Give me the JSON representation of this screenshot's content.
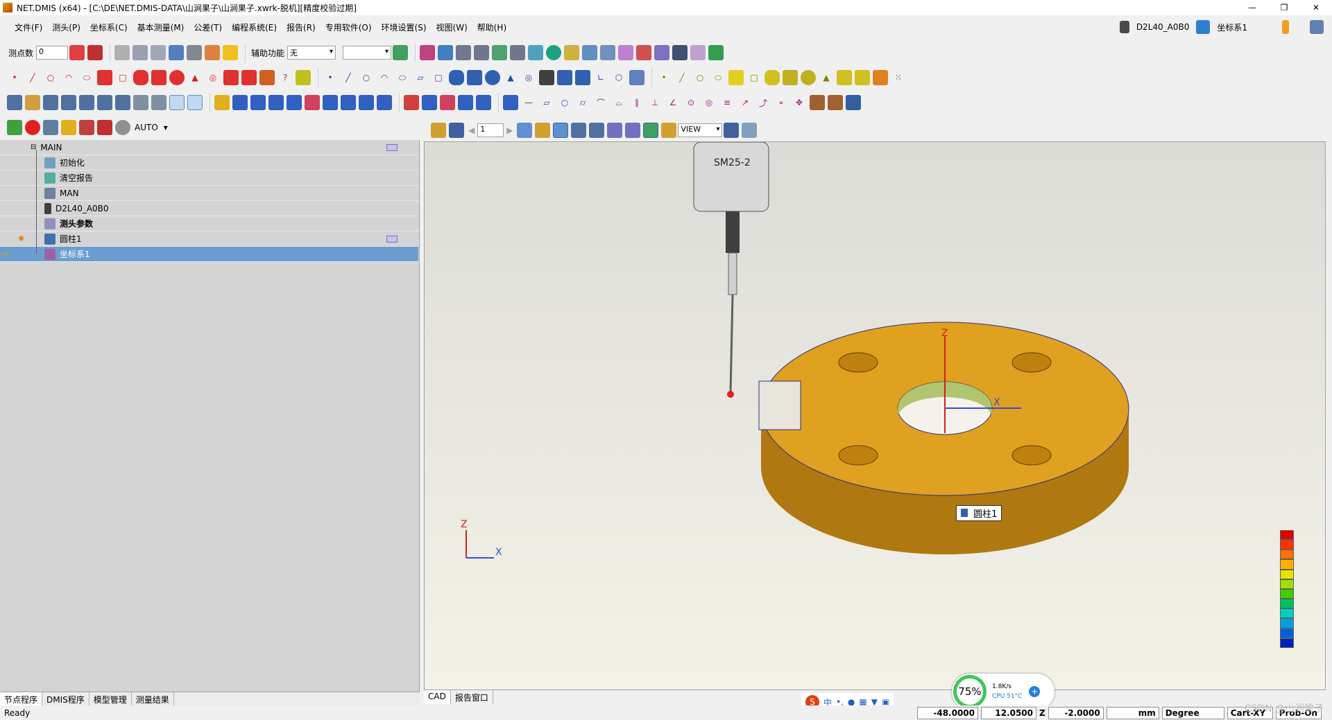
{
  "window": {
    "title": "NET.DMIS (x64) - [C:\\DE\\NET.DMIS-DATA\\山涧果子\\山涧果子.xwrk-脱机][精度校验过期]",
    "controls": [
      "—",
      "❐",
      "✕"
    ]
  },
  "menu": {
    "items": [
      "文件(F)",
      "测头(P)",
      "坐标系(C)",
      "基本测量(M)",
      "公差(T)",
      "编程系统(E)",
      "报告(R)",
      "专用软件(O)",
      "环境设置(S)",
      "视图(W)",
      "帮助(H)"
    ],
    "probe_name": "D2L40_A0B0",
    "coord_system": "坐标系1"
  },
  "toolbar": {
    "points_label": "测点数",
    "points_value": "0",
    "aux_label": "辅助功能",
    "aux_value": "无",
    "mode_value": "AUTO"
  },
  "tree": {
    "nodes": [
      {
        "label": "MAIN"
      },
      {
        "label": "初始化"
      },
      {
        "label": "清空报告"
      },
      {
        "label": "MAN"
      },
      {
        "label": "D2L40_A0B0"
      },
      {
        "label": "测头参数"
      },
      {
        "label": "圆柱1"
      },
      {
        "label": "坐标系1"
      }
    ]
  },
  "left_tabs": [
    "节点程序",
    "DMIS程序",
    "模型管理",
    "测量结果"
  ],
  "view": {
    "page_value": "1",
    "view_select": "VIEW",
    "probe_text": "SM25-2",
    "feature_label": "圆柱1",
    "axis_labels": {
      "z": "Z",
      "x": "X"
    },
    "color_scale": [
      "#e00000",
      "#ff3000",
      "#ff7000",
      "#ffb000",
      "#e8e000",
      "#a0e000",
      "#40d000",
      "#00c060",
      "#00d0c0",
      "#00a0e0",
      "#0060e0",
      "#0020c0"
    ],
    "part_color": "#e0a020"
  },
  "view_tabs": [
    "CAD",
    "报告窗口"
  ],
  "status": {
    "text": "Ready",
    "x_value": "-48.0000",
    "y_value": "12.0500",
    "z_label": "Z",
    "z_value": "-2.0000",
    "unit": "mm",
    "angle": "Degree",
    "plane": "Cart-XY",
    "prob": "Prob-On"
  },
  "perf": {
    "percent": "75%",
    "speed": "1.8K/s",
    "cpu": "CPU 51°C"
  },
  "watermark": "CSDN @山涧果子"
}
